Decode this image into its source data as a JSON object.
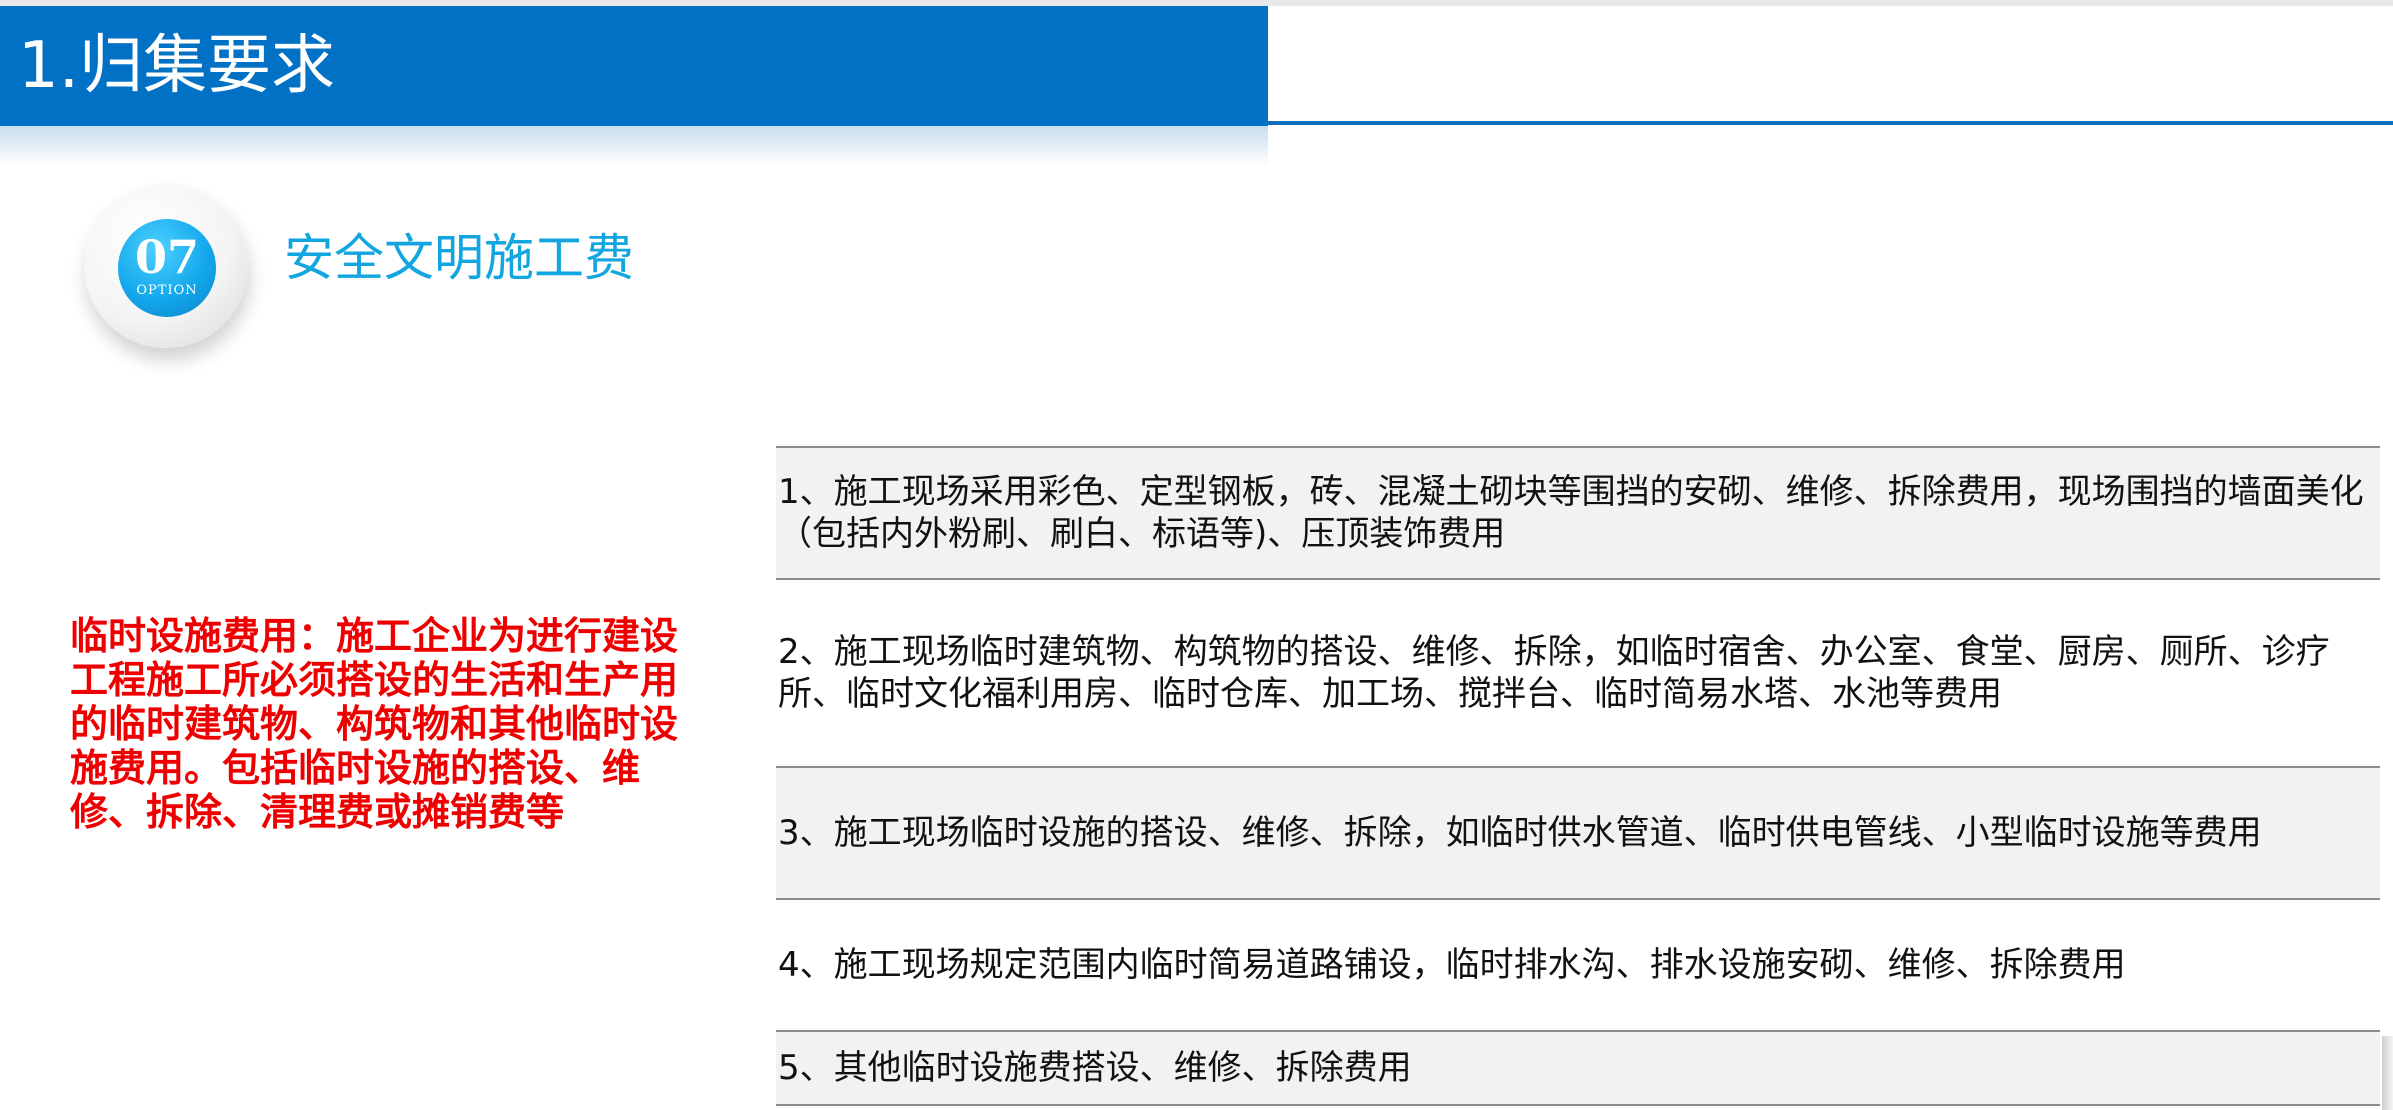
{
  "header": {
    "title": "1.归集要求"
  },
  "badge": {
    "number": "07",
    "sub": "OPTION"
  },
  "section": {
    "title": "安全文明施工费"
  },
  "definition": {
    "text": "临时设施费用：施工企业为进行建设工程施工所必须搭设的生活和生产用的临时建筑物、构筑物和其他临时设施费用。包括临时设施的搭设、维修、拆除、清理费或摊销费等"
  },
  "items": [
    {
      "text": "1、施工现场采用彩色、定型钢板，砖、混凝土砌块等围挡的安砌、维修、拆除费用，现场围挡的墙面美化（包括内外粉刷、刷白、标语等)、压顶装饰费用"
    },
    {
      "text": "2、施工现场临时建筑物、构筑物的搭设、维修、拆除，如临时宿舍、办公室、食堂、厨房、厕所、诊疗所、临时文化福利用房、临时仓库、加工场、搅拌台、临时简易水塔、水池等费用"
    },
    {
      "text": "3、施工现场临时设施的搭设、维修、拆除，如临时供水管道、临时供电管线、小型临时设施等费用"
    },
    {
      "text": "4、施工现场规定范围内临时简易道路铺设，临时排水沟、排水设施安砌、维修、拆除费用"
    },
    {
      "text": "5、其他临时设施费搭设、维修、拆除费用"
    }
  ],
  "colors": {
    "header_blue": "#0071c5",
    "accent_cyan": "#12a6e0",
    "definition_red": "#ee0000"
  }
}
